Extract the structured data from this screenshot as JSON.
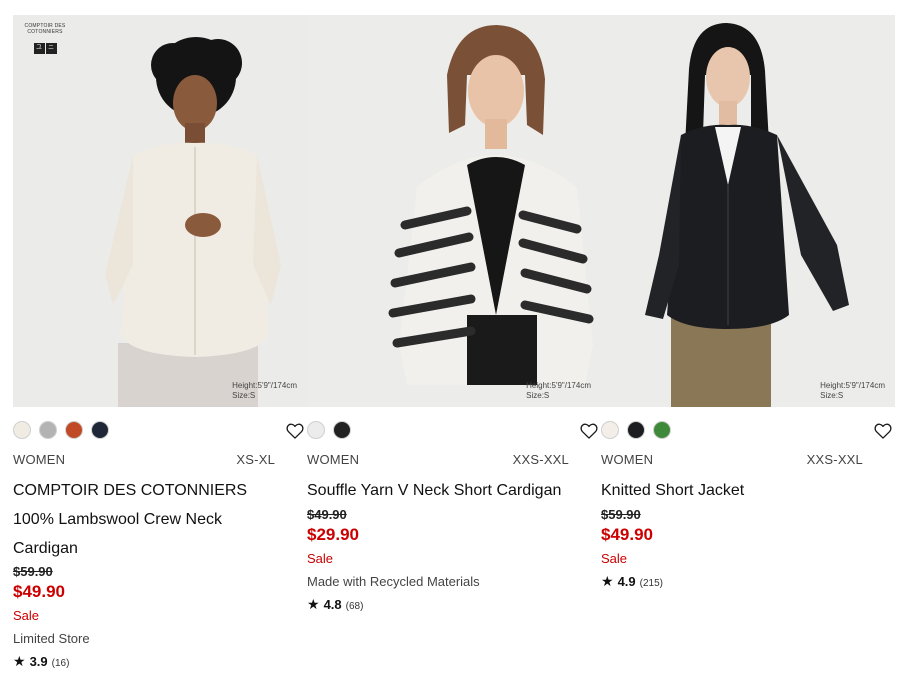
{
  "products": [
    {
      "brand_logo": {
        "brand_name": "COMPTOIR DES COTONNIERS",
        "uniqlo_glyphs": [
          "ユ",
          "ニ"
        ]
      },
      "model_note": [
        "Height:5'9\"/174cm",
        "Size:S"
      ],
      "swatch_colors": [
        "#f1ece3",
        "#b3b3b3",
        "#c04a26",
        "#1f2637"
      ],
      "gender": "WOMEN",
      "size_range": "XS-XL",
      "name_lines": [
        "COMPTOIR DES COTONNIERS",
        "100% Lambswool Crew Neck",
        "Cardigan"
      ],
      "original_price": "$59.90",
      "price": "$49.90",
      "sale_label": "Sale",
      "extra_note": "Limited Store",
      "rating": "3.9",
      "review_count": "(16)"
    },
    {
      "model_note": [
        "Height:5'9\"/174cm",
        "Size:S"
      ],
      "swatch_colors": [
        "#ececec",
        "#222222"
      ],
      "gender": "WOMEN",
      "size_range": "XXS-XXL",
      "name_lines": [
        "Souffle Yarn V Neck Short Cardigan"
      ],
      "original_price": "$49.90",
      "price": "$29.90",
      "sale_label": "Sale",
      "extra_note": "Made with Recycled Materials",
      "rating": "4.8",
      "review_count": "(68)"
    },
    {
      "model_note": [
        "Height:5'9\"/174cm",
        "Size:S"
      ],
      "swatch_colors": [
        "#f3eee8",
        "#1c1d20",
        "#3f8a3a"
      ],
      "gender": "WOMEN",
      "size_range": "XXS-XXL",
      "name_lines": [
        "Knitted Short Jacket"
      ],
      "original_price": "$59.90",
      "price": "$49.90",
      "sale_label": "Sale",
      "rating": "4.9",
      "review_count": "(215)"
    }
  ],
  "colors": {
    "sale_red": "#cc0000",
    "text_dark": "#1b1b1b",
    "photo_bg": "#ececec"
  },
  "icons": {
    "favorite": "heart-outline-icon",
    "rating": "star-icon"
  }
}
